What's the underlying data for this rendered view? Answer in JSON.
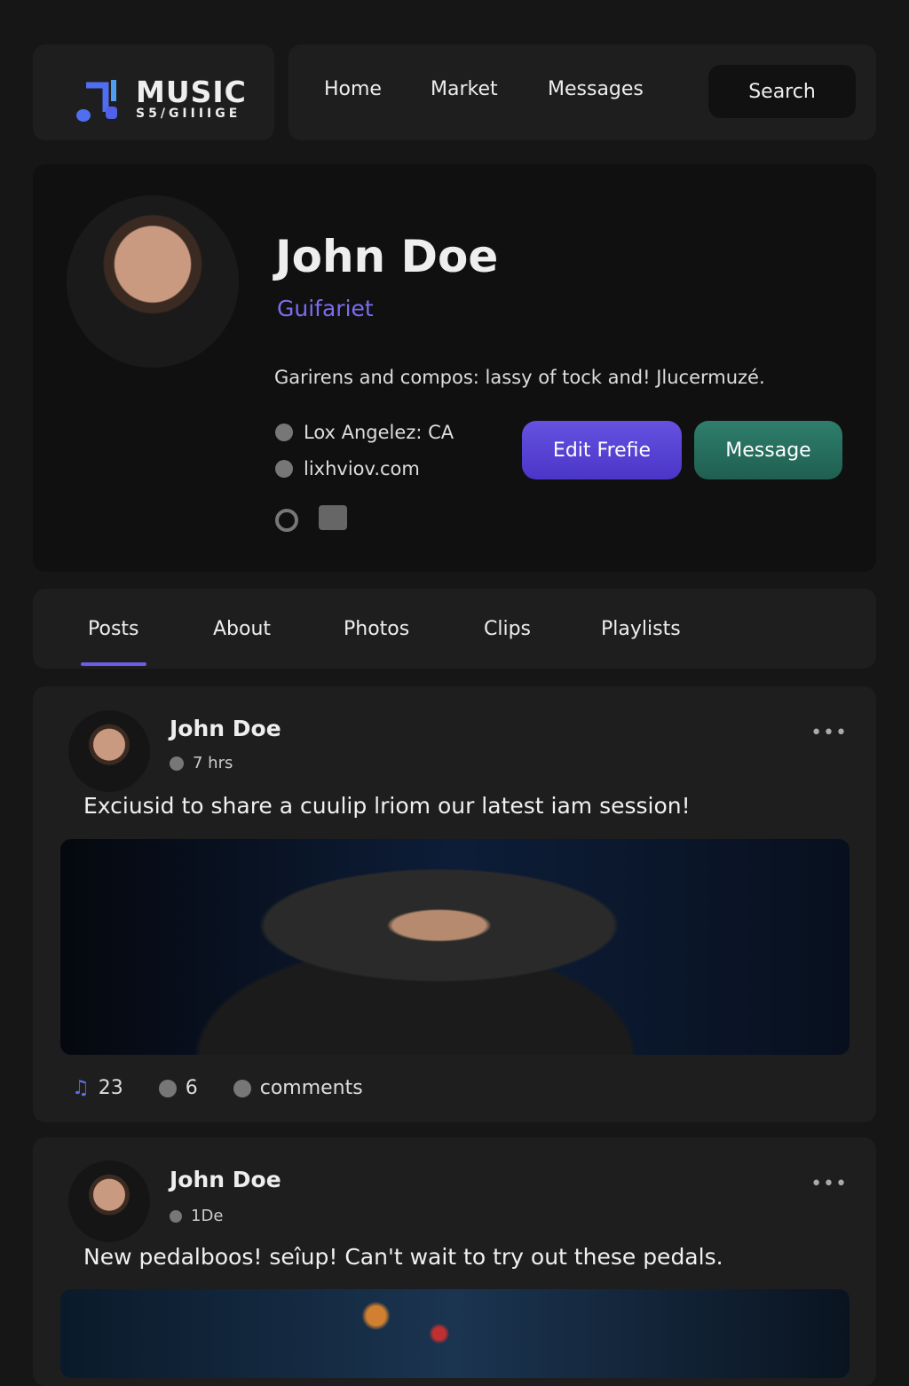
{
  "logo": {
    "title": "MUSIC",
    "subtitle": "S5/GIIIIGE"
  },
  "nav": {
    "items": [
      "Home",
      "Market",
      "Messages"
    ],
    "search": "Search"
  },
  "profile": {
    "name": "John Doe",
    "role": "Guifariet",
    "bio": "Garirens and compos: lassy of tock and! Jlucermuzé.",
    "location": "Lox Angelez: CA",
    "website": "lixhviov.com",
    "edit_label": "Edit Frefie",
    "message_label": "Message"
  },
  "tabs": [
    "Posts",
    "About",
    "Photos",
    "Clips",
    "Playlists"
  ],
  "posts": [
    {
      "author": "John Doe",
      "meta": "7 hrs",
      "text": "Exciusid to share a cuulip lriom our latest iam session!",
      "likes": "23",
      "comments": "6",
      "comments_label": "comments"
    },
    {
      "author": "John Doe",
      "meta": "1De",
      "text": "New pedalboos! seîup! Can't wait to try out these pedals."
    }
  ],
  "colors": {
    "accent": "#6a5ee8",
    "edit": "#5541d6",
    "message": "#2a7262"
  }
}
